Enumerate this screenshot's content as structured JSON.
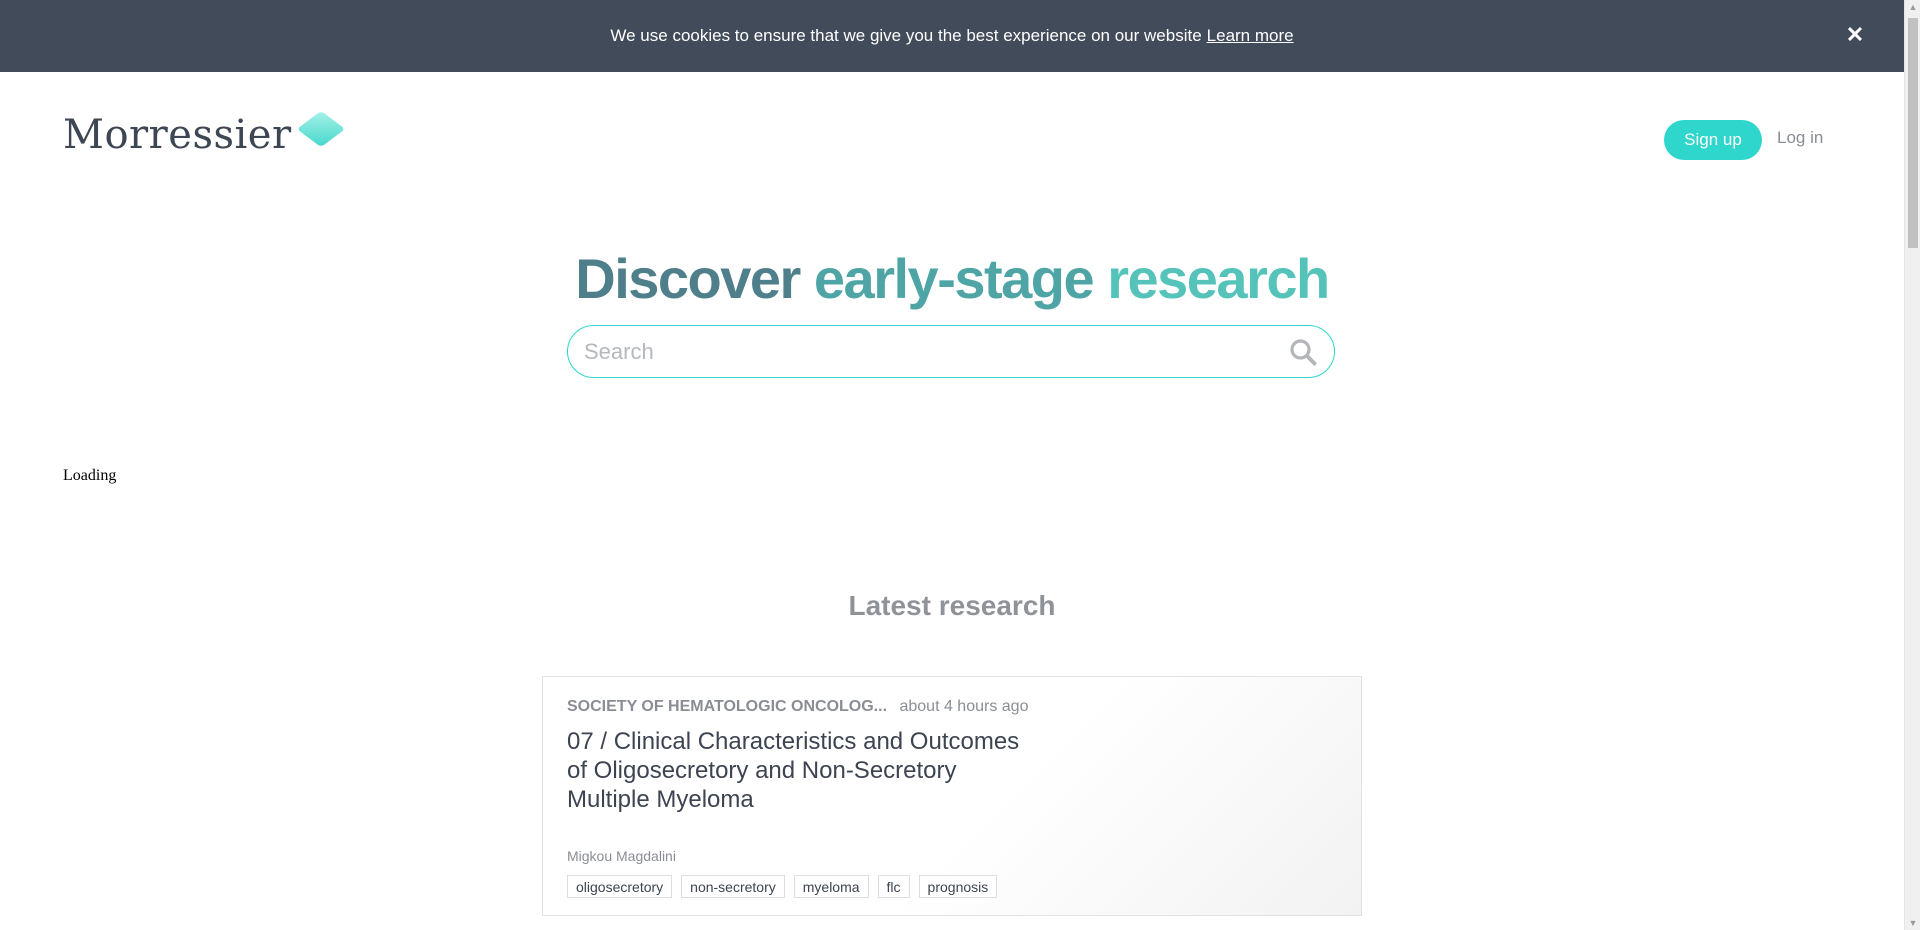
{
  "cookie_banner": {
    "message": "We use cookies to ensure that we give you the best experience on our website",
    "link_label": "Learn more",
    "close_glyph": "✕"
  },
  "header": {
    "logo_text": "Morressier",
    "signup_label": "Sign up",
    "login_label": "Log in"
  },
  "hero": {
    "title_word1": "Discover",
    "title_word2": "early-stage",
    "title_word3": "research",
    "search_placeholder": "Search",
    "search_value": ""
  },
  "status": {
    "loading_text": "Loading"
  },
  "latest": {
    "heading": "Latest research",
    "cards": [
      {
        "source": "SOCIETY OF HEMATOLOGIC ONCOLOG...",
        "time": "about 4 hours ago",
        "title": "07 / Clinical Characteristics and Outcomes of Oligosecretory and Non-Secretory Multiple Myeloma",
        "author": "Migkou Magdalini",
        "tags": [
          "oligosecretory",
          "non-secretory",
          "myeloma",
          "flc",
          "prognosis"
        ]
      }
    ]
  },
  "colors": {
    "cookie_bg": "#414b59",
    "accent": "#2ed6cb",
    "title_dark_teal": "#4f7f8a",
    "title_mid_teal": "#4fa5a5",
    "title_light_teal": "#55c3b9",
    "muted_text": "#8a8e94"
  },
  "icons": {
    "close": "close-icon",
    "search": "search-icon",
    "logo_mark": "diamond-logo-icon"
  }
}
